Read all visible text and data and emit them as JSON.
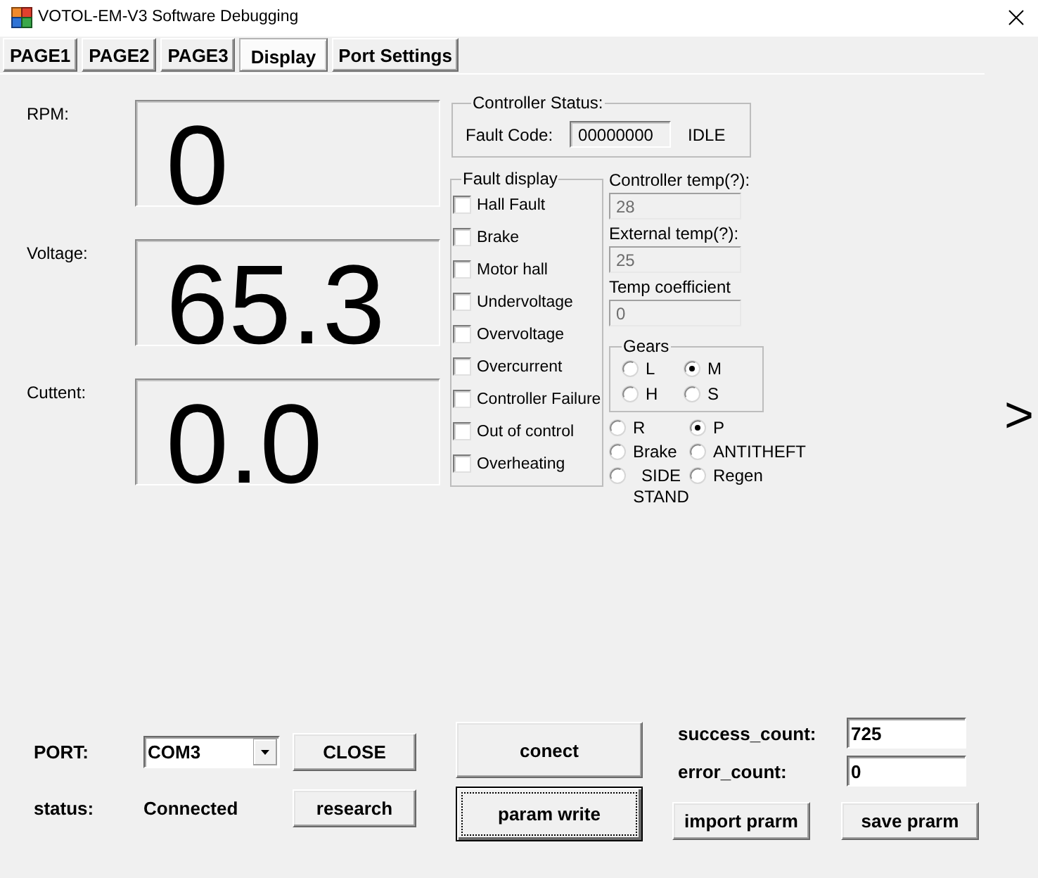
{
  "window": {
    "title": "VOTOL-EM-V3 Software Debugging"
  },
  "tabs": [
    {
      "label": "PAGE1",
      "selected": false
    },
    {
      "label": "PAGE2",
      "selected": false
    },
    {
      "label": "PAGE3",
      "selected": false
    },
    {
      "label": "Display",
      "selected": true
    },
    {
      "label": "Port Settings",
      "selected": false
    }
  ],
  "readouts": [
    {
      "label": "RPM:",
      "value": "0"
    },
    {
      "label": "Voltage:",
      "value": "65.3"
    },
    {
      "label": "Cuttent:",
      "value": "0.0"
    }
  ],
  "controller_status": {
    "title": "Controller Status:",
    "fault_code_label": "Fault Code:",
    "fault_code": "00000000",
    "state": "IDLE"
  },
  "fault_display": {
    "title": "Fault display",
    "items": [
      {
        "label": "Hall Fault",
        "checked": false
      },
      {
        "label": "Brake",
        "checked": false
      },
      {
        "label": "Motor hall",
        "checked": false
      },
      {
        "label": "Undervoltage",
        "checked": false
      },
      {
        "label": "Overvoltage",
        "checked": false
      },
      {
        "label": "Overcurrent",
        "checked": false
      },
      {
        "label": "Controller Failure",
        "checked": false
      },
      {
        "label": "Out of control",
        "checked": false
      },
      {
        "label": "Overheating",
        "checked": false
      }
    ]
  },
  "temperatures": [
    {
      "label": "Controller temp(?):",
      "value": "28",
      "disabled": true
    },
    {
      "label": "External temp(?):",
      "value": "25",
      "disabled": true
    },
    {
      "label": "Temp coefficient",
      "value": "0",
      "disabled": true
    }
  ],
  "gears": {
    "title": "Gears",
    "options": [
      {
        "label": "L",
        "selected": false
      },
      {
        "label": "M",
        "selected": true
      },
      {
        "label": "H",
        "selected": false
      },
      {
        "label": "S",
        "selected": false
      }
    ]
  },
  "modes": [
    {
      "label": "R",
      "selected": false
    },
    {
      "label": "P",
      "selected": true
    },
    {
      "label": "Brake",
      "selected": false
    },
    {
      "label": "ANTITHEFT",
      "selected": false
    },
    {
      "label": "SIDE STAND",
      "selected": false
    },
    {
      "label": "Regen",
      "selected": false
    }
  ],
  "next_button": ">",
  "connection": {
    "port_label": "PORT:",
    "port": "COM3",
    "close_button": "CLOSE",
    "status_label": "status:",
    "status": "Connected",
    "research_button": "research"
  },
  "actions": [
    {
      "label": "conect",
      "focused": false
    },
    {
      "label": "param write",
      "focused": true
    }
  ],
  "counters": [
    {
      "label": "success_count:",
      "value": "725"
    },
    {
      "label": "error_count:",
      "value": "0"
    }
  ],
  "file_buttons": [
    "import prarm",
    "save prarm"
  ]
}
